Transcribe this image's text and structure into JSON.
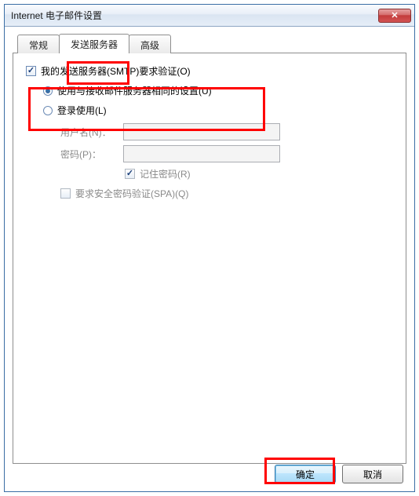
{
  "titlebar": {
    "title": "Internet 电子邮件设置"
  },
  "tabs": [
    {
      "label": "常规",
      "active": false
    },
    {
      "label": "发送服务器",
      "active": true
    },
    {
      "label": "高级",
      "active": false
    }
  ],
  "main_checkbox": {
    "label": "我的发送服务器(SMTP)要求验证(O)",
    "checked": true
  },
  "radios": {
    "same_as_incoming": {
      "label": "使用与接收邮件服务器相同的设置(U)",
      "selected": true
    },
    "login_with": {
      "label": "登录使用(L)",
      "selected": false
    }
  },
  "login_fields": {
    "username_label": "用户名(N)：",
    "username_value": "",
    "password_label": "密码(P)：",
    "password_value": "",
    "remember_pw": {
      "label": "记住密码(R)",
      "checked": true
    },
    "spa": {
      "label": "要求安全密码验证(SPA)(Q)",
      "checked": false
    }
  },
  "buttons": {
    "ok": "确定",
    "cancel": "取消"
  }
}
